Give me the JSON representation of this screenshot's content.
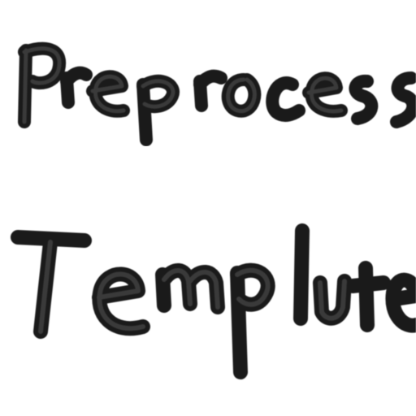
{
  "handwriting": {
    "line_1": "Preprocess",
    "line_2": "Template"
  },
  "colors": {
    "ink": "#1a1a1a",
    "background": "#ffffff"
  }
}
